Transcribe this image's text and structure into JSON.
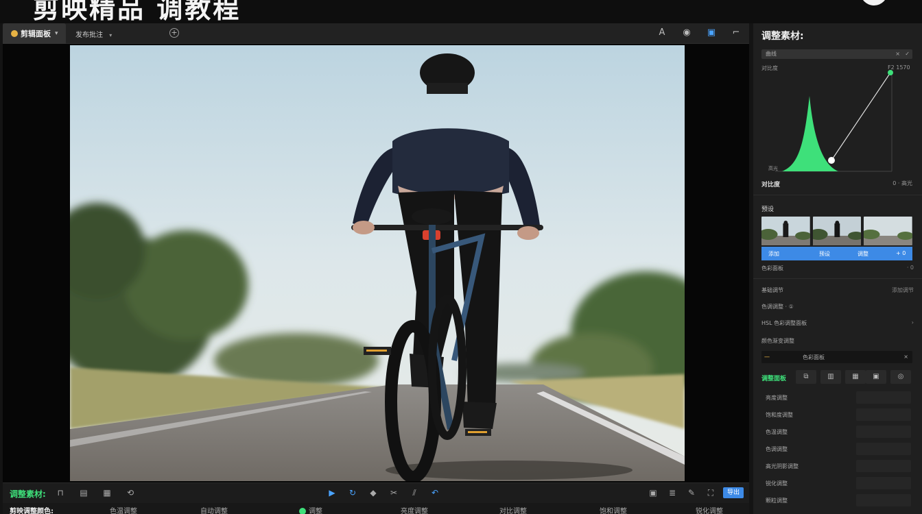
{
  "banner": {
    "title": "剪映精品 调教程"
  },
  "toolbar": {
    "tab_active": "剪辑面板",
    "tab_second": "发布批注",
    "right_icons": [
      "text-style-icon",
      "eye-icon",
      "layout-icon",
      "crop-icon"
    ]
  },
  "right_panel": {
    "title": "调整素材:",
    "search_label": "曲线",
    "curve_label": "对比度",
    "curve_value": "F2 1570",
    "curve_bottom_label": "高光",
    "row_a_label": "对比度",
    "row_a_right": "0 · 高光",
    "section_thumbs": "预设",
    "thumb_bar": [
      "添加",
      "预设",
      "调整",
      "+ 0"
    ],
    "sub_label": "色彩面板",
    "sub_label_right": "· 0",
    "rows": [
      {
        "label": "基础调节",
        "right": "添加调节"
      },
      {
        "label": "色调调整 · ①",
        "right": ""
      },
      {
        "label": "HSL 色彩调整面板",
        "right": "›"
      },
      {
        "label": "颜色渐变调整",
        "right": ""
      }
    ],
    "dark_row_left": "一",
    "dark_row_label": "色彩面板",
    "tabs_label": "调整面板",
    "tab_icons": [
      "copy-icon",
      "panel-icon",
      "grid-icon",
      "frame-icon",
      "user-icon"
    ],
    "props": [
      "亮度调整",
      "饱和度调整",
      "色温调整",
      "色调调整",
      "高光阴影调整",
      "锐化调整",
      "颗粒调整"
    ]
  },
  "bottom": {
    "label": "调整素材:",
    "button": "导出",
    "strip": [
      "剪映调整颜色:",
      "色温调整",
      "自动调整",
      "调整",
      "亮度调整",
      "对比调整",
      "饱和调整",
      "锐化调整"
    ]
  },
  "colors": {
    "accent_green": "#3ee07a",
    "accent_blue": "#3d8ae6"
  }
}
